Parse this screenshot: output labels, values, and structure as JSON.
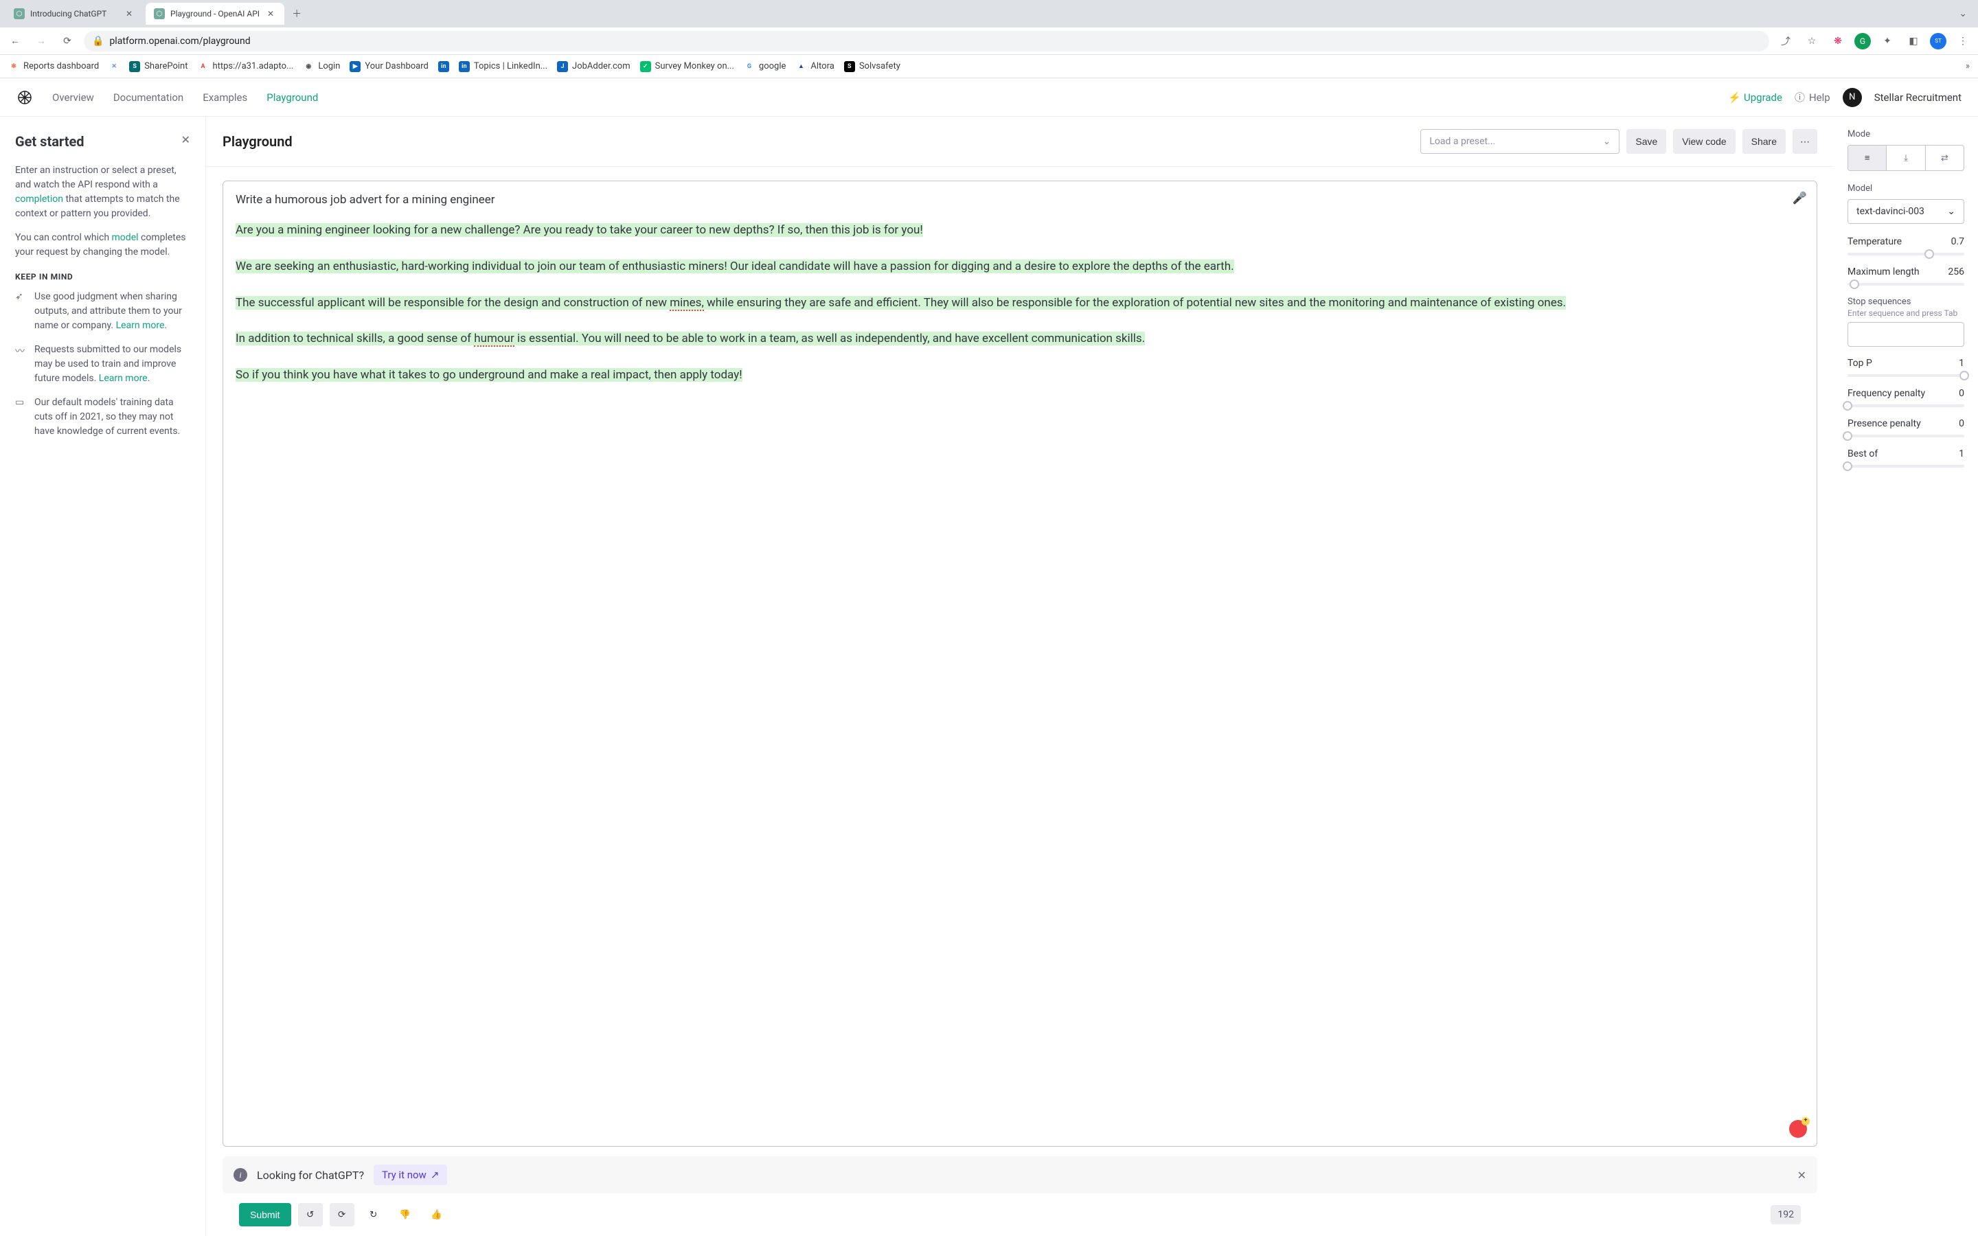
{
  "browser": {
    "tabs": [
      {
        "title": "Introducing ChatGPT",
        "active": false
      },
      {
        "title": "Playground - OpenAI API",
        "active": true
      }
    ],
    "url": "platform.openai.com/playground"
  },
  "bookmarks": [
    {
      "label": "Reports dashboard",
      "color": "#ff7a59"
    },
    {
      "label": "",
      "color": "#5b8def"
    },
    {
      "label": "SharePoint",
      "color": "#036c70"
    },
    {
      "label": "https://a31.adapto...",
      "color": "#e03e2d"
    },
    {
      "label": "Login",
      "color": "#555"
    },
    {
      "label": "Your Dashboard",
      "color": "#0a66c2"
    },
    {
      "label": "",
      "color": "#0a66c2"
    },
    {
      "label": "Topics | LinkedIn...",
      "color": "#0a66c2"
    },
    {
      "label": "JobAdder.com",
      "color": "#0a66c2"
    },
    {
      "label": "Survey Monkey on...",
      "color": "#00bf6f"
    },
    {
      "label": "google",
      "color": "#4285f4"
    },
    {
      "label": "Altora",
      "color": "#1e4d8c"
    },
    {
      "label": "Solvsafety",
      "color": "#000"
    }
  ],
  "nav": {
    "overview": "Overview",
    "documentation": "Documentation",
    "examples": "Examples",
    "playground": "Playground",
    "upgrade": "Upgrade",
    "help": "Help",
    "avatar_letter": "N",
    "org": "Stellar Recruitment"
  },
  "sidebar": {
    "title": "Get started",
    "intro_a": "Enter an instruction or select a preset, and watch the API respond with a ",
    "completion_word": "completion",
    "intro_b": " that attempts to match the context or pattern you provided.",
    "model_a": "You can control which ",
    "model_word": "model",
    "model_b": " completes your request by changing the model.",
    "keep_title": "KEEP IN MIND",
    "tips": [
      {
        "text_a": "Use good judgment when sharing outputs, and attribute them to your name or company. ",
        "link": "Learn more",
        "text_b": "."
      },
      {
        "text_a": "Requests submitted to our models may be used to train and improve future models. ",
        "link": "Learn more",
        "text_b": "."
      },
      {
        "text_a": "Our default models' training data cuts off in 2021, so they may not have knowledge of current events.",
        "link": "",
        "text_b": ""
      }
    ]
  },
  "center": {
    "title": "Playground",
    "preset_placeholder": "Load a preset...",
    "save": "Save",
    "view_code": "View code",
    "share": "Share",
    "prompt": "Write a humorous job advert for a mining engineer",
    "completion": {
      "p1": "Are you a mining engineer looking for a new challenge? Are you ready to take your career to new depths? If so, then this job is for you!",
      "p2a": "We are seeking an enthusiastic, hard-working individual to join our team of enthusiastic miners! Our ideal candidate will have a passion for digging and a desire to explore the depths of the earth.",
      "p3a": "The successful applicant will be responsible for the design and construction of new ",
      "p3_mines": "mines,",
      "p3b": " while ensuring they are safe and efficient. They will also be responsible for the exploration of potential new sites and the monitoring and maintenance of existing ones.",
      "p4a": "In addition to technical skills, a good sense of ",
      "p4_humour": "humour",
      "p4b": " is essential. You will need to be able to work in a team, as well as independently, and have excellent communication skills.",
      "p5": "So if you think you have what it takes to go underground and make a real impact, then apply today!"
    },
    "banner_text": "Looking for ChatGPT?",
    "banner_cta": "Try it now",
    "submit": "Submit",
    "token_count": "192"
  },
  "rail": {
    "mode_label": "Mode",
    "model_label": "Model",
    "model_value": "text-davinci-003",
    "temperature_label": "Temperature",
    "temperature_value": "0.7",
    "maxlen_label": "Maximum length",
    "maxlen_value": "256",
    "stop_label": "Stop sequences",
    "stop_hint": "Enter sequence and press Tab",
    "topp_label": "Top P",
    "topp_value": "1",
    "freq_label": "Frequency penalty",
    "freq_value": "0",
    "pres_label": "Presence penalty",
    "pres_value": "0",
    "best_label": "Best of",
    "best_value": "1"
  },
  "colors": {
    "accent": "#10a37f",
    "completion_bg": "#d2f4d3"
  }
}
